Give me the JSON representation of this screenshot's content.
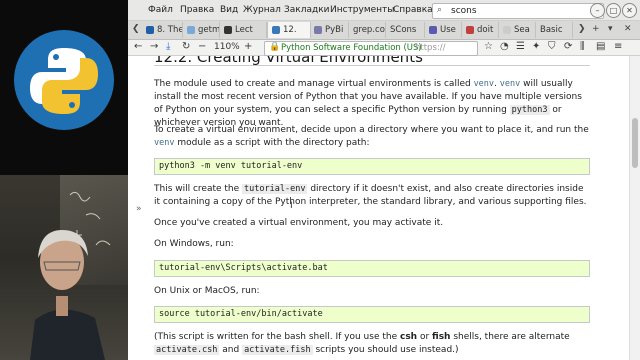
{
  "menubar": {
    "items": [
      "Файл",
      "Правка",
      "Вид",
      "Журнал",
      "Закладки",
      "Инструменты",
      "Справка"
    ],
    "search_text": "scons",
    "controls": [
      "–",
      "□",
      "✕"
    ]
  },
  "tabs": [
    {
      "label": "8. The",
      "favicon": "#1f5fa6"
    },
    {
      "label": "getm",
      "favicon": "#7aa8d8"
    },
    {
      "label": "Lect",
      "favicon": "#333333"
    },
    {
      "label": "12.",
      "favicon": "#3a78b8",
      "active": true
    },
    {
      "label": "PyBi",
      "favicon": "#7a7aa8"
    },
    {
      "label": "grep.co",
      "favicon": "#cccccc"
    },
    {
      "label": "SCons",
      "favicon": "#cccccc"
    },
    {
      "label": "Use",
      "favicon": "#5a5ab0"
    },
    {
      "label": "doit",
      "favicon": "#c04040"
    },
    {
      "label": "Sea",
      "favicon": "#cccccc"
    },
    {
      "label": "Basic",
      "favicon": "#cccccc"
    }
  ],
  "navbar": {
    "zoom": "110%",
    "site_identity": "Python Software Foundation (US)",
    "url_fragment": "https://"
  },
  "page": {
    "heading": "12.2. Creating Virtual Environments",
    "p1_a": "The module used to create and manage virtual environments is called ",
    "p1_code1": "venv",
    "p1_b": ". ",
    "p1_code2": "venv",
    "p1_c": " will usually install the most recent version of Python that you have available. If you have multiple versions of Python on your system, you can select a specific Python version by running ",
    "p1_code3": "python3",
    "p1_d": " or whichever version you want.",
    "p2_a": "To create a virtual environment, decide upon a directory where you want to place it, and run the ",
    "p2_code": "venv",
    "p2_b": " module as a script with the directory path:",
    "code1": "python3 -m venv tutorial-env",
    "p3_a": "This will create the ",
    "p3_code": "tutorial-env",
    "p3_b": " directory if it doesn't exist, and also create directories inside it containing a copy of the Python interpreter, the standard library, and various supporting files.",
    "p4": "Once you've created a virtual environment, you may activate it.",
    "p5": "On Windows, run:",
    "code2": "tutorial-env\\Scripts\\activate.bat",
    "p6": "On Unix or MacOS, run:",
    "code3": "source tutorial-env/bin/activate",
    "p7_a": "(This script is written for the bash shell. If you use the ",
    "p7_b1": "csh",
    "p7_c": " or ",
    "p7_b2": "fish",
    "p7_d": " shells, there are alternate ",
    "p7_code1": "activate.csh",
    "p7_e": " and ",
    "p7_code2": "activate.fish",
    "p7_f": " scripts you should use instead.)",
    "sidebar_toggle": "»"
  },
  "colors": {
    "code_block_bg": "#eeffcc",
    "inline_code": "#3e6d8e",
    "site_identity": "#1d7a1d"
  }
}
